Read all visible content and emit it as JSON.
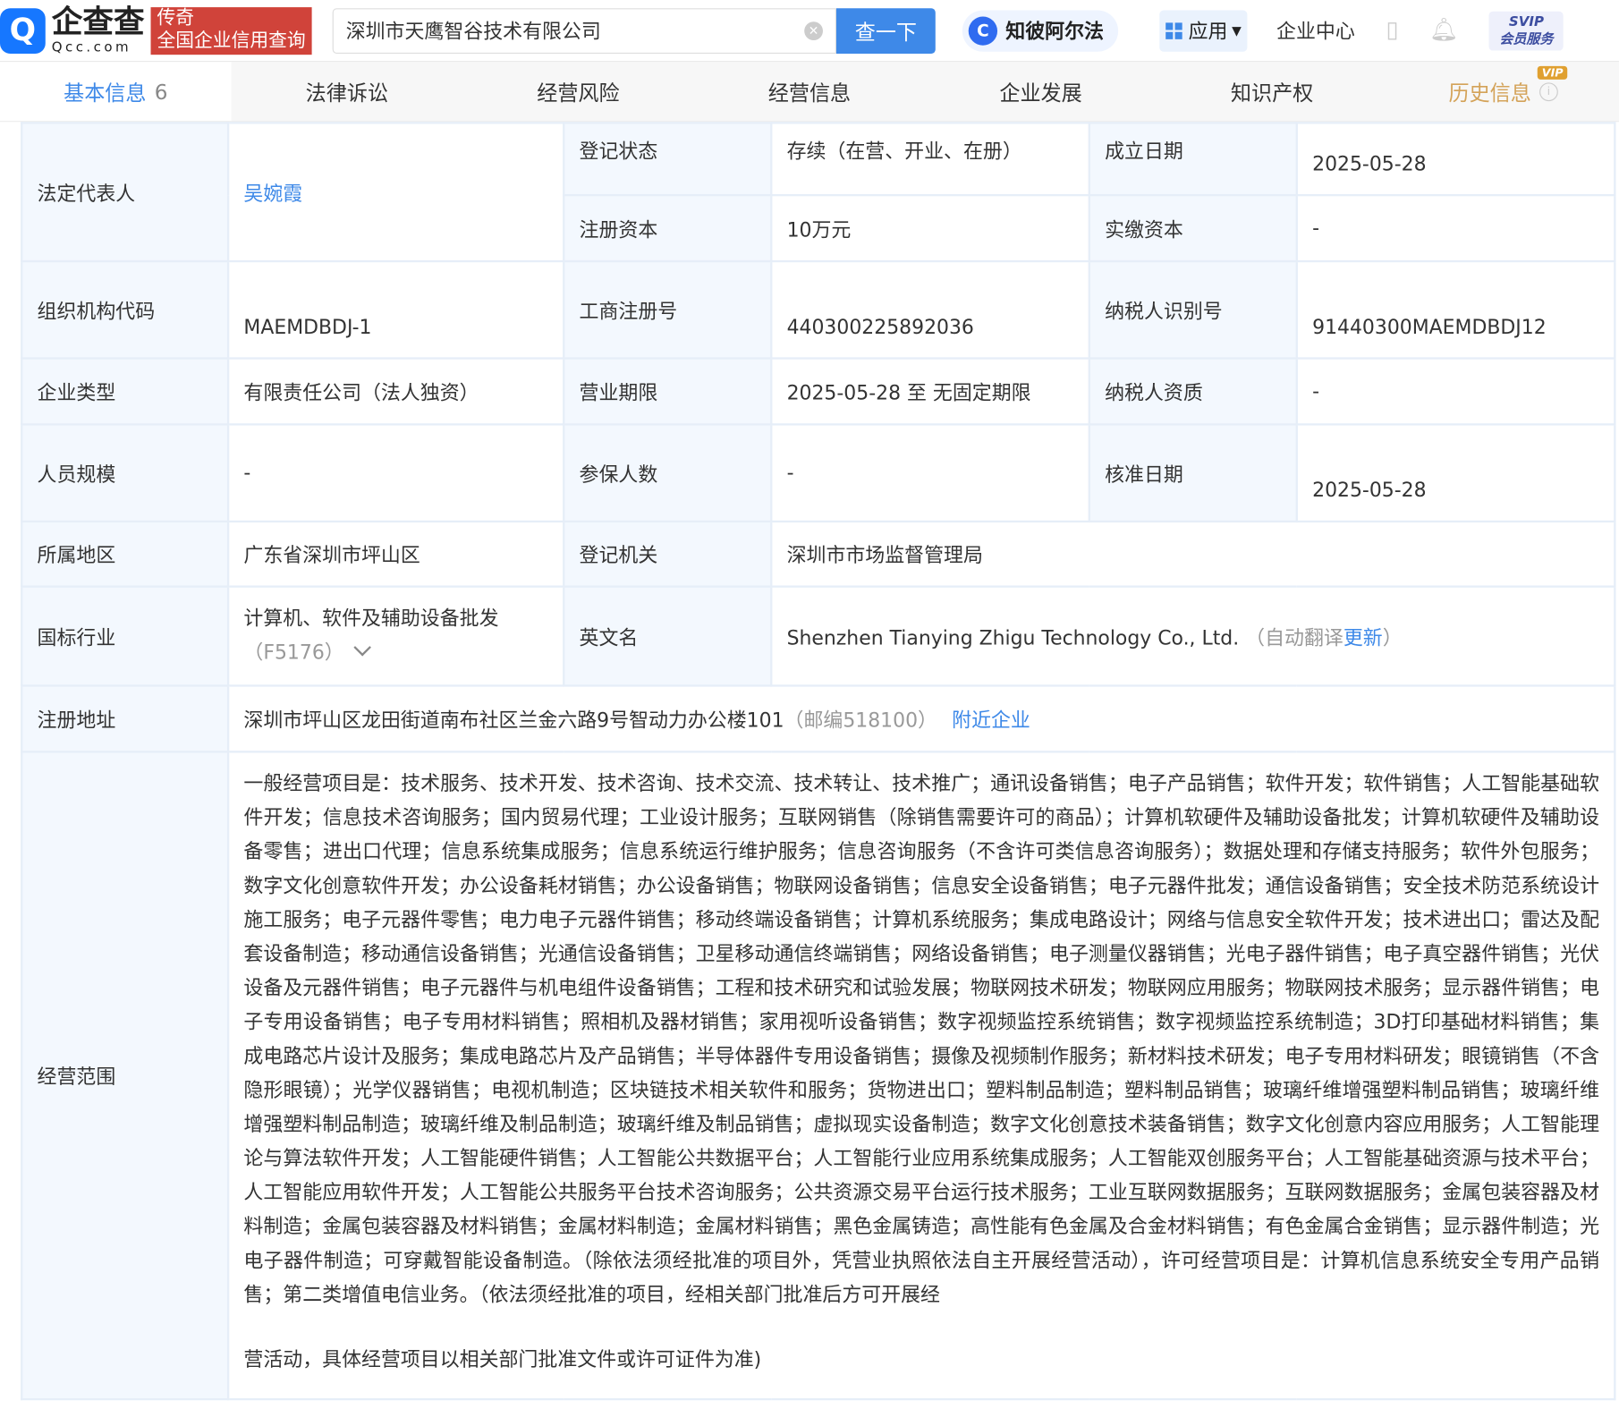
{
  "header": {
    "logo_text": "企查查",
    "logo_domain": "Qcc.com",
    "ad_line1": "传奇",
    "ad_line2": "全国企业信用查询",
    "search_value": "深圳市天鹰智谷技术有限公司",
    "search_button": "查一下",
    "zhibi": "知彼阿尔法",
    "apps": "应用",
    "enterprise_center": "企业中心",
    "svip_line1": "SVIP",
    "svip_line2": "会员服务"
  },
  "tabs": [
    {
      "label": "基本信息",
      "count": "6"
    },
    {
      "label": "法律诉讼"
    },
    {
      "label": "经营风险"
    },
    {
      "label": "经营信息"
    },
    {
      "label": "企业发展"
    },
    {
      "label": "知识产权"
    },
    {
      "label": "历史信息",
      "badge": "VIP"
    }
  ],
  "info": {
    "legal_rep_label": "法定代表人",
    "legal_rep": "吴婉霞",
    "reg_status_label": "登记状态",
    "reg_status": "存续（在营、开业、在册）",
    "founded_label": "成立日期",
    "founded": "2025-05-28",
    "reg_capital_label": "注册资本",
    "reg_capital": "10万元",
    "paid_capital_label": "实缴资本",
    "paid_capital": "-",
    "org_code_label": "组织机构代码",
    "org_code": "MAEMDBDJ-1",
    "biz_reg_no_label": "工商注册号",
    "biz_reg_no": "440300225892036",
    "taxpayer_id_label": "纳税人识别号",
    "taxpayer_id": "91440300MAEMDBDJ12",
    "company_type_label": "企业类型",
    "company_type": "有限责任公司（法人独资）",
    "term_label": "营业期限",
    "term": "2025-05-28 至 无固定期限",
    "taxpayer_qual_label": "纳税人资质",
    "taxpayer_qual": "-",
    "staff_size_label": "人员规模",
    "staff_size": "-",
    "insured_label": "参保人数",
    "insured": "-",
    "approval_date_label": "核准日期",
    "approval_date": "2025-05-28",
    "region_label": "所属地区",
    "region": "广东省深圳市坪山区",
    "authority_label": "登记机关",
    "authority": "深圳市市场监督管理局",
    "industry_label": "国标行业",
    "industry": "计算机、软件及辅助设备批发",
    "industry_code": "（F5176）",
    "english_name_label": "英文名",
    "english_name": "Shenzhen Tianying Zhigu Technology Co., Ltd.",
    "auto_translate": "（自动翻译",
    "update": "更新",
    "close_paren": "）",
    "address_label": "注册地址",
    "address": "深圳市坪山区龙田街道南布社区兰金六路9号智动力办公楼101",
    "postcode": "（邮编518100）",
    "nearby": "附近企业",
    "scope_label": "经营范围",
    "scope": "一般经营项目是：技术服务、技术开发、技术咨询、技术交流、技术转让、技术推广；通讯设备销售；电子产品销售；软件开发；软件销售；人工智能基础软件开发；信息技术咨询服务；国内贸易代理；工业设计服务；互联网销售（除销售需要许可的商品）；计算机软硬件及辅助设备批发；计算机软硬件及辅助设备零售；进出口代理；信息系统集成服务；信息系统运行维护服务；信息咨询服务（不含许可类信息咨询服务）；数据处理和存储支持服务；软件外包服务；数字文化创意软件开发；办公设备耗材销售；办公设备销售；物联网设备销售；信息安全设备销售；电子元器件批发；通信设备销售；安全技术防范系统设计施工服务；电子元器件零售；电力电子元器件销售；移动终端设备销售；计算机系统服务；集成电路设计；网络与信息安全软件开发；技术进出口；雷达及配套设备制造；移动通信设备销售；光通信设备销售；卫星移动通信终端销售；网络设备销售；电子测量仪器销售；光电子器件销售；电子真空器件销售；光伏设备及元器件销售；电子元器件与机电组件设备销售；工程和技术研究和试验发展；物联网技术研发；物联网应用服务；物联网技术服务；显示器件销售；电子专用设备销售；电子专用材料销售；照相机及器材销售；家用视听设备销售；数字视频监控系统销售；数字视频监控系统制造；3D打印基础材料销售；集成电路芯片设计及服务；集成电路芯片及产品销售；半导体器件专用设备销售；摄像及视频制作服务；新材料技术研发；电子专用材料研发；眼镜销售（不含隐形眼镜）；光学仪器销售；电视机制造；区块链技术相关软件和服务；货物进出口；塑料制品制造；塑料制品销售；玻璃纤维增强塑料制品销售；玻璃纤维增强塑料制品制造；玻璃纤维及制品制造；玻璃纤维及制品销售；虚拟现实设备制造；数字文化创意技术装备销售；数字文化创意内容应用服务；人工智能理论与算法软件开发；人工智能硬件销售；人工智能公共数据平台；人工智能行业应用系统集成服务；人工智能双创服务平台；人工智能基础资源与技术平台；人工智能应用软件开发；人工智能公共服务平台技术咨询服务；公共资源交易平台运行技术服务；工业互联网数据服务；互联网数据服务；金属包装容器及材料制造；金属包装容器及材料销售；金属材料制造；金属材料销售；黑色金属铸造；高性能有色金属及合金材料销售；有色金属合金销售；显示器件制造；光电子器件制造；可穿戴智能设备制造。（除依法须经批准的项目外，凭营业执照依法自主开展经营活动），许可经营项目是：计算机信息系统安全专用产品销售；第二类增值电信业务。（依法须经批准的项目，经相关部门批准后方可开展经",
    "scope_tail": "营活动，具体经营项目以相关部门批准文件或许可证件为准)"
  }
}
